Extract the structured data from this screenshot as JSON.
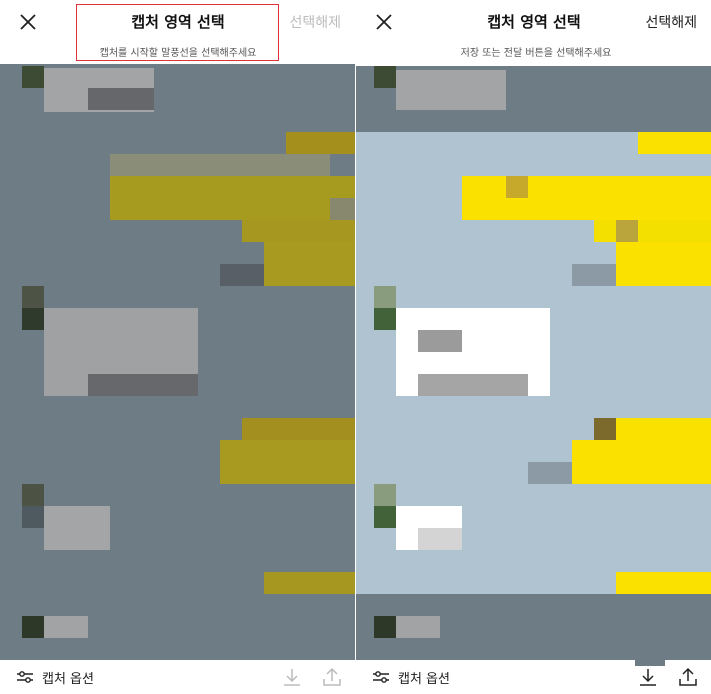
{
  "screens": [
    {
      "title": "캡처 영역 선택",
      "deselect_label": "선택해제",
      "instruction": "캡처를 시작할 말풍선을 선택해주세요",
      "close_icon": "close-icon",
      "footer": {
        "options_label": "캡처 옵션",
        "options_icon": "sliders-icon",
        "download_icon": "download-icon",
        "share_icon": "share-icon"
      },
      "state": "no-selection"
    },
    {
      "title": "캡처 영역 선택",
      "deselect_label": "선택해제",
      "instruction": "저장 또는 전달 버튼을 선택해주세요",
      "close_icon": "close-icon",
      "footer": {
        "options_label": "캡처 옵션",
        "options_icon": "sliders-icon",
        "download_icon": "download-icon",
        "share_icon": "share-icon"
      },
      "state": "selected"
    }
  ],
  "colors": {
    "chat_background": "#6e7c86",
    "selection_highlight": "#b0c3d0",
    "annotation_box": "#e0313a",
    "bubble_yellow": "#fae100",
    "bubble_white": "#ffffff"
  }
}
